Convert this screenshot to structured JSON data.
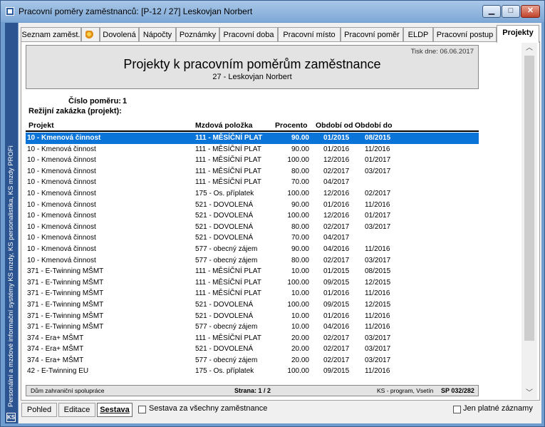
{
  "window": {
    "title": "Pracovní poměry zaměstnanců: [P-12 / 27] Leskovjan Norbert"
  },
  "sidebar": {
    "text": "Personální a mzdové informační systémy KS mzdy, KS personalistika, KS mzdy PROFi",
    "logo": "KS"
  },
  "tabs": [
    {
      "label": "Seznam zaměst."
    },
    {
      "label": ""
    },
    {
      "label": "Dovolená"
    },
    {
      "label": "Nápočty"
    },
    {
      "label": "Poznámky"
    },
    {
      "label": "Pracovní doba"
    },
    {
      "label": "Pracovní místo"
    },
    {
      "label": "Pracovní poměr"
    },
    {
      "label": "ELDP"
    },
    {
      "label": "Pracovní postup"
    },
    {
      "label": "Projekty"
    }
  ],
  "report": {
    "print_date": "Tisk dne: 06.06.2017",
    "title": "Projekty k pracovním poměrům zaměstnance",
    "subtitle": "27 - Leskovjan Norbert",
    "contract_label": "Číslo poměru:",
    "contract_value": "1",
    "overhead_label": "Režijní zakázka (projekt):",
    "columns": {
      "project": "Projekt",
      "wage_item": "Mzdová položka",
      "percent": "Procento",
      "from": "Období od",
      "to": "Období do"
    },
    "rows": [
      {
        "project": "10 - Kmenová činnost",
        "wage_item": "111 - MĚSÍČNÍ PLAT",
        "percent": "90.00",
        "from": "01/2015",
        "to": "08/2015"
      },
      {
        "project": "10 - Kmenová činnost",
        "wage_item": "111 - MĚSÍČNÍ PLAT",
        "percent": "90.00",
        "from": "01/2016",
        "to": "11/2016"
      },
      {
        "project": "10 - Kmenová činnost",
        "wage_item": "111 - MĚSÍČNÍ PLAT",
        "percent": "100.00",
        "from": "12/2016",
        "to": "01/2017"
      },
      {
        "project": "10 - Kmenová činnost",
        "wage_item": "111 - MĚSÍČNÍ PLAT",
        "percent": "80.00",
        "from": "02/2017",
        "to": "03/2017"
      },
      {
        "project": "10 - Kmenová činnost",
        "wage_item": "111 - MĚSÍČNÍ PLAT",
        "percent": "70.00",
        "from": "04/2017",
        "to": ""
      },
      {
        "project": "10 - Kmenová činnost",
        "wage_item": "175 - Os. příplatek",
        "percent": "100.00",
        "from": "12/2016",
        "to": "02/2017"
      },
      {
        "project": "10 - Kmenová činnost",
        "wage_item": "521 - DOVOLENÁ",
        "percent": "90.00",
        "from": "01/2016",
        "to": "11/2016"
      },
      {
        "project": "10 - Kmenová činnost",
        "wage_item": "521 - DOVOLENÁ",
        "percent": "100.00",
        "from": "12/2016",
        "to": "01/2017"
      },
      {
        "project": "10 - Kmenová činnost",
        "wage_item": "521 - DOVOLENÁ",
        "percent": "80.00",
        "from": "02/2017",
        "to": "03/2017"
      },
      {
        "project": "10 - Kmenová činnost",
        "wage_item": "521 - DOVOLENÁ",
        "percent": "70.00",
        "from": "04/2017",
        "to": ""
      },
      {
        "project": "10 - Kmenová činnost",
        "wage_item": "577 - obecný zájem",
        "percent": "90.00",
        "from": "04/2016",
        "to": "11/2016"
      },
      {
        "project": "10 - Kmenová činnost",
        "wage_item": "577 - obecný zájem",
        "percent": "80.00",
        "from": "02/2017",
        "to": "03/2017"
      },
      {
        "project": "371 - E-Twinning MŠMT",
        "wage_item": "111 - MĚSÍČNÍ PLAT",
        "percent": "10.00",
        "from": "01/2015",
        "to": "08/2015"
      },
      {
        "project": "371 - E-Twinning MŠMT",
        "wage_item": "111 - MĚSÍČNÍ PLAT",
        "percent": "100.00",
        "from": "09/2015",
        "to": "12/2015"
      },
      {
        "project": "371 - E-Twinning MŠMT",
        "wage_item": "111 - MĚSÍČNÍ PLAT",
        "percent": "10.00",
        "from": "01/2016",
        "to": "11/2016"
      },
      {
        "project": "371 - E-Twinning MŠMT",
        "wage_item": "521 - DOVOLENÁ",
        "percent": "100.00",
        "from": "09/2015",
        "to": "12/2015"
      },
      {
        "project": "371 - E-Twinning MŠMT",
        "wage_item": "521 - DOVOLENÁ",
        "percent": "10.00",
        "from": "01/2016",
        "to": "11/2016"
      },
      {
        "project": "371 - E-Twinning MŠMT",
        "wage_item": "577 - obecný zájem",
        "percent": "10.00",
        "from": "04/2016",
        "to": "11/2016"
      },
      {
        "project": "374 - Era+ MŠMT",
        "wage_item": "111 - MĚSÍČNÍ PLAT",
        "percent": "20.00",
        "from": "02/2017",
        "to": "03/2017"
      },
      {
        "project": "374 - Era+ MŠMT",
        "wage_item": "521 - DOVOLENÁ",
        "percent": "20.00",
        "from": "02/2017",
        "to": "03/2017"
      },
      {
        "project": "374 - Era+ MŠMT",
        "wage_item": "577 - obecný zájem",
        "percent": "20.00",
        "from": "02/2017",
        "to": "03/2017"
      },
      {
        "project": "42 - E-Twinning EU",
        "wage_item": "175 - Os. příplatek",
        "percent": "100.00",
        "from": "09/2015",
        "to": "11/2016"
      }
    ],
    "footer": {
      "left": "Dům zahraniční spolupráce",
      "page": "Strana: 1 / 2",
      "vendor": "KS - program, Vsetín",
      "code": "SP 032/282"
    }
  },
  "bottom": {
    "view_tabs": [
      "Pohled",
      "Editace",
      "Sestava"
    ],
    "all_employees_label": "Sestava za všechny zaměstnance",
    "valid_only_label": "Jen platné záznamy"
  }
}
